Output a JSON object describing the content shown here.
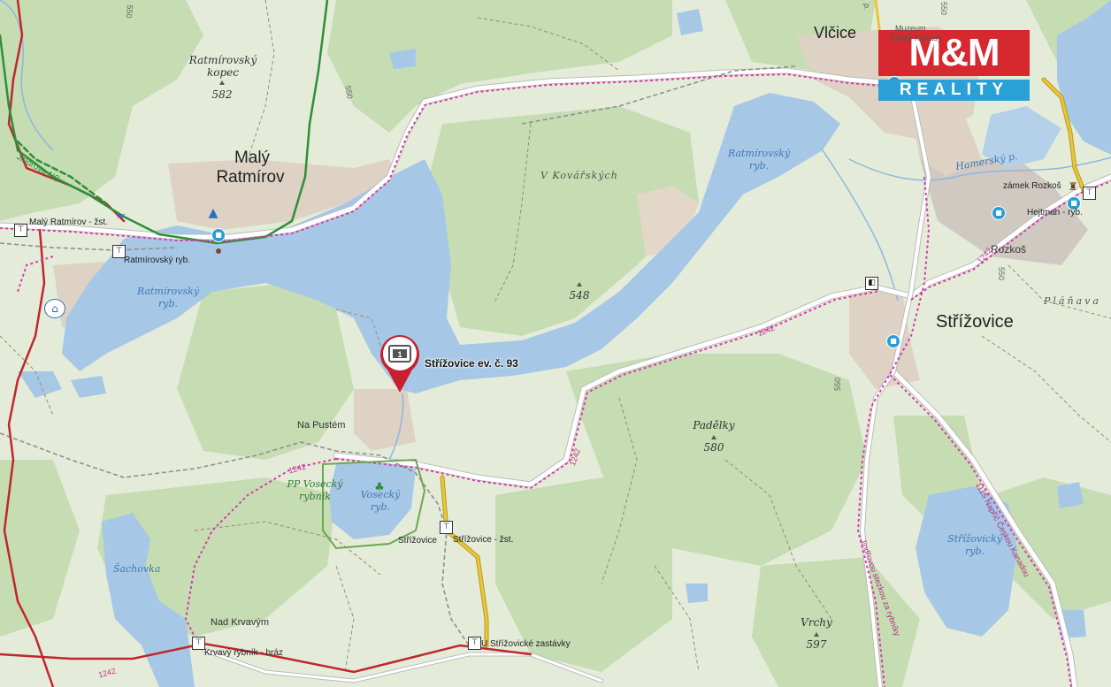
{
  "brand": {
    "top": "M&M",
    "bottom": "REALITY"
  },
  "marker": {
    "label": "Střížovice ev. č. 93",
    "icon": "property-pin-icon"
  },
  "towns": {
    "vlcice": "Vlčice",
    "maly_ratmirov_1": "Malý",
    "maly_ratmirov_2": "Ratmírov",
    "strizovice": "Střížovice",
    "rozkos": "Rozkoš"
  },
  "water": {
    "ratmirovsky_1": "Ratmírovský",
    "ratmirovsky_2": "ryb.",
    "ratmirovsky_east_1": "Ratmírovský",
    "ratmirovsky_east_2": "ryb.",
    "vosecky_1": "Vosecký",
    "vosecky_2": "ryb.",
    "strizovicky_1": "Střížovický",
    "strizovicky_2": "ryb.",
    "sachovka": "Šachovka",
    "hamersky": "Hamerský p."
  },
  "hills": {
    "ratmirovsky_kopec_1": "Ratmírovský",
    "ratmirovsky_kopec_2": "kopec",
    "ratmirovsky_kopec_elev": "582",
    "h548": "548",
    "padelky": "Padělky",
    "padelky_elev": "580",
    "vrchy": "Vrchy",
    "vrchy_elev": "597"
  },
  "localities": {
    "v_kovarskych": "V Kovářských",
    "planava": "Pláňava",
    "na_pustem": "Na Pustém",
    "nad_krvavym": "Nad Krvavým"
  },
  "park": {
    "line1": "PP Vosecký",
    "line2": "rybník"
  },
  "stops": {
    "maly_ratmirov_zst": "Malý Ratmírov - žst.",
    "ratmirovsky_ryb": "Ratmírovský ryb.",
    "strizovice_zst": "Střížovice - žst.",
    "strizovice": "Střížovice",
    "krvavy_rybnik_hraz": "Krvavý rybník - hráz",
    "u_strizovicke": "U Střížovické zastávky",
    "zamek_rozkos": "zámek Rozkoš",
    "hejtman_ryb": "Hejtman - ryb.",
    "muzeum_1": "Muzeum",
    "muzeum_2": "České Kanady"
  },
  "routes": {
    "jindrova_ns": "Jindřova NS",
    "road_1242": "1242",
    "road_1242_b": "1242",
    "road_1242_c": "1242",
    "road_1242_d": "1242",
    "road_1242_e": "1242",
    "route_550": "550",
    "route_550_b": "550",
    "route_550_c": "550",
    "route_550_d": "550",
    "route_550_e": "550",
    "jindrovou_stezkou": "Jindřovou stezkou za rybníky",
    "napric_ceskou_kanadou": "1115 Napříč Českou Kanadou",
    "p_label": "p."
  },
  "colors": {
    "forest": "#c5dcb0",
    "meadow": "#e4ecd9",
    "water": "#a6c8e6",
    "village": "#ded4c6",
    "cycle_route": "#d93aa8",
    "hiking_red": "#c0272d",
    "hiking_green": "#2f8f3a",
    "road_yellow": "#e9c634",
    "marker": "#c8202f"
  }
}
